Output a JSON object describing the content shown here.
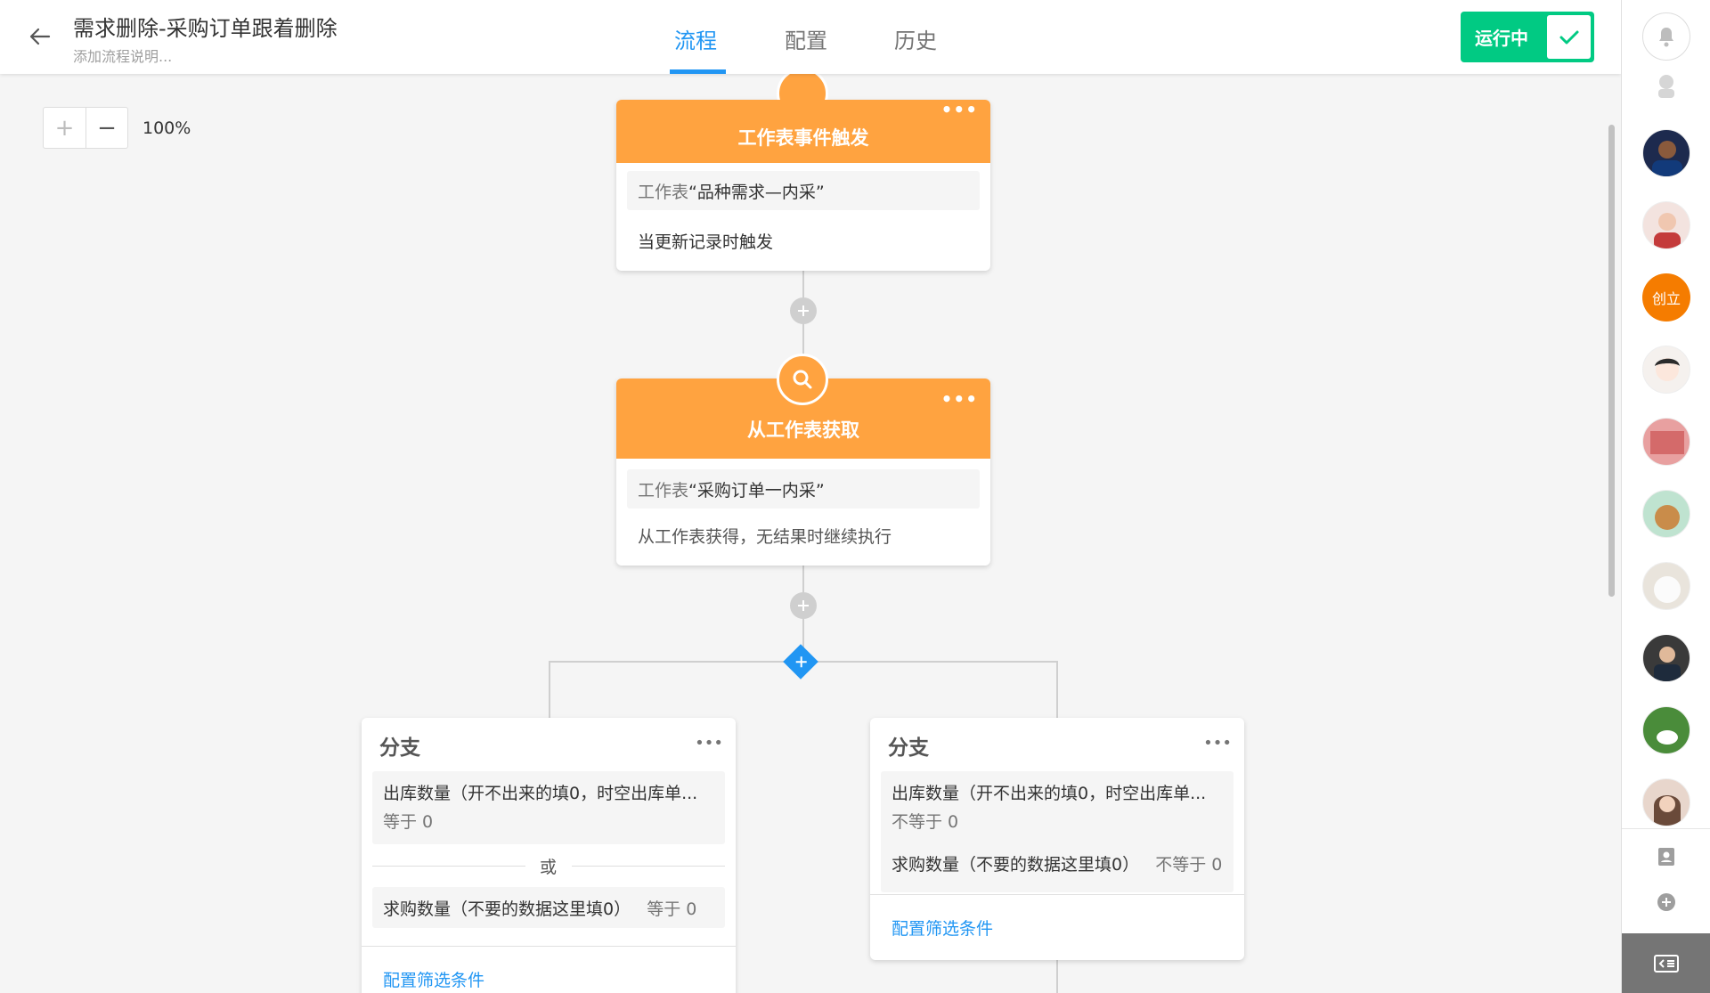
{
  "header": {
    "title": "需求删除-采购订单跟着删除",
    "subtitle": "添加流程说明...",
    "tabs": [
      "流程",
      "配置",
      "历史"
    ],
    "run_status": "运行中"
  },
  "zoom": {
    "plus": "+",
    "minus": "−",
    "level": "100%"
  },
  "nodes": {
    "trigger": {
      "title": "工作表事件触发",
      "sheet_prefix": "工作表",
      "sheet_name": "“品种需求—内采”",
      "desc": "当更新记录时触发",
      "menu": "•••"
    },
    "fetch": {
      "title": "从工作表获取",
      "sheet_prefix": "工作表",
      "sheet_name": "“采购订单一内采”",
      "desc": "从工作表获得，无结果时继续执行",
      "menu": "•••"
    }
  },
  "branches": [
    {
      "title": "分支",
      "cond1_field": "出库数量（开不出来的填0，时空出库单...",
      "cond1_op": "等于 0",
      "or_text": "或",
      "cond2_field": "求购数量（不要的数据这里填0）",
      "cond2_op": "等于 0",
      "filter_link": "配置筛选条件"
    },
    {
      "title": "分支",
      "cond1_field": "出库数量（开不出来的填0，时空出库单...",
      "cond1_op": "不等于 0",
      "cond2_field": "求购数量（不要的数据这里填0）",
      "cond2_op": "不等于 0",
      "filter_link": "配置筛选条件"
    }
  ],
  "sidebar": {
    "creator_avatar_text": "创立",
    "icons": [
      "bell-icon",
      "contacts-icon",
      "add-chat-icon",
      "collapse-icon"
    ]
  },
  "colors": {
    "accent": "#2196f3",
    "node_orange": "#ffa340",
    "run_green": "#01ca83",
    "avatar_orange": "#f57c00"
  }
}
